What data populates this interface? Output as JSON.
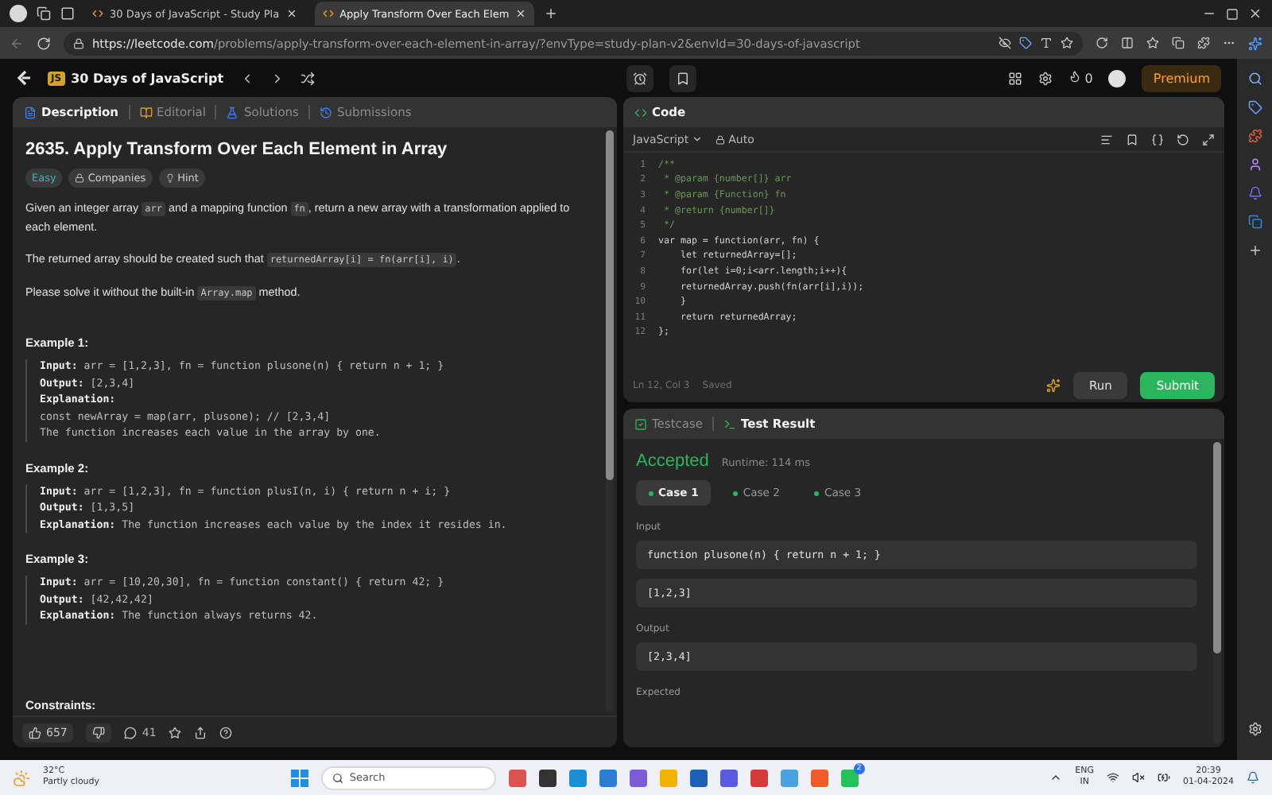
{
  "browser": {
    "tabs": [
      {
        "title": "30 Days of JavaScript - Study Pla",
        "selected": false
      },
      {
        "title": "Apply Transform Over Each Elem",
        "selected": true
      }
    ],
    "url_host": "https://leetcode.com",
    "url_path": "/problems/apply-transform-over-each-element-in-array/?envType=study-plan-v2&envId=30-days-of-javascript"
  },
  "header": {
    "badge": "JS",
    "study_plan": "30 Days of JavaScript",
    "streak": "0",
    "premium": "Premium"
  },
  "description_tabs": [
    {
      "label": "Description",
      "selected": true
    },
    {
      "label": "Editorial",
      "selected": false
    },
    {
      "label": "Solutions",
      "selected": false
    },
    {
      "label": "Submissions",
      "selected": false
    }
  ],
  "problem": {
    "title": "2635. Apply Transform Over Each Element in Array",
    "tags": [
      {
        "label": "Easy",
        "kind": "difficulty"
      },
      {
        "label": "Companies",
        "kind": "lock"
      },
      {
        "label": "Hint",
        "kind": "hint"
      }
    ],
    "paragraphs": [
      [
        {
          "text": "Given an integer array ",
          "kind": "text"
        },
        {
          "text": "arr",
          "kind": "code"
        },
        {
          "text": " and a mapping function ",
          "kind": "text"
        },
        {
          "text": "fn",
          "kind": "code"
        },
        {
          "text": ", return a new array with a transformation applied to each element.",
          "kind": "text"
        }
      ],
      [
        {
          "text": "The returned array should be created such that ",
          "kind": "text"
        },
        {
          "text": "returnedArray[i] = fn(arr[i], i)",
          "kind": "code"
        },
        {
          "text": ".",
          "kind": "text"
        }
      ],
      [
        {
          "text": "Please solve it without the built-in ",
          "kind": "text"
        },
        {
          "text": "Array.map",
          "kind": "code"
        },
        {
          "text": " method.",
          "kind": "text"
        }
      ]
    ],
    "examples": [
      {
        "title": "Example 1:",
        "lines": [
          "**Input:** arr = [1,2,3], fn = function plusone(n) { return n + 1; }",
          "**Output:** [2,3,4]",
          "**Explanation:**",
          "const newArray = map(arr, plusone); // [2,3,4]",
          "The function increases each value in the array by one."
        ]
      },
      {
        "title": "Example 2:",
        "lines": [
          "**Input:** arr = [1,2,3], fn = function plusI(n, i) { return n + i; }",
          "**Output:** [1,3,5]",
          "**Explanation:** The function increases each value by the index it resides in."
        ]
      },
      {
        "title": "Example 3:",
        "lines": [
          "**Input:** arr = [10,20,30], fn = function constant() { return 42; }",
          "**Output:** [42,42,42]",
          "**Explanation:** The function always returns 42."
        ]
      }
    ],
    "constraints_title": "Constraints:"
  },
  "footer": {
    "likes": "657",
    "comments": "41"
  },
  "editor": {
    "title": "Code",
    "language": "JavaScript",
    "mode": "Auto",
    "lines": [
      {
        "number": "1",
        "text": "/**",
        "kind": "comment"
      },
      {
        "number": "2",
        "text": " * @param {number[]} arr",
        "kind": "comment"
      },
      {
        "number": "3",
        "text": " * @param {Function} fn",
        "kind": "comment"
      },
      {
        "number": "4",
        "text": " * @return {number[]}",
        "kind": "comment"
      },
      {
        "number": "5",
        "text": " */",
        "kind": "comment"
      },
      {
        "number": "6",
        "text": "var map = function(arr, fn) {",
        "kind": "code"
      },
      {
        "number": "7",
        "text": "    let returnedArray=[];",
        "kind": "code"
      },
      {
        "number": "8",
        "text": "    for(let i=0;i<arr.length;i++){",
        "kind": "code"
      },
      {
        "number": "9",
        "text": "    returnedArray.push(fn(arr[i],i));",
        "kind": "code"
      },
      {
        "number": "10",
        "text": "    }",
        "kind": "code"
      },
      {
        "number": "11",
        "text": "    return returnedArray;",
        "kind": "code"
      },
      {
        "number": "12",
        "text": "};",
        "kind": "code"
      }
    ],
    "status": "Ln 12, Col 3",
    "saved": "Saved",
    "run": "Run",
    "submit": "Submit"
  },
  "results": {
    "tabs": [
      {
        "label": "Testcase",
        "selected": false
      },
      {
        "label": "Test Result",
        "selected": true
      }
    ],
    "verdict": "Accepted",
    "runtime": "Runtime: 114 ms",
    "cases": [
      {
        "label": "Case 1",
        "selected": true
      },
      {
        "label": "Case 2",
        "selected": false
      },
      {
        "label": "Case 3",
        "selected": false
      }
    ],
    "sections": [
      {
        "label": "Input",
        "values": [
          "function plusone(n) { return n + 1; }",
          "[1,2,3]"
        ]
      },
      {
        "label": "Output",
        "values": [
          "[2,3,4]"
        ]
      },
      {
        "label": "Expected"
      }
    ]
  },
  "taskbar": {
    "temperature": "32°C",
    "condition": "Partly cloudy",
    "search": "Search",
    "notification_count": "2",
    "language": "ENG",
    "region": "IN",
    "time": "20:39",
    "date": "01-04-2024"
  }
}
